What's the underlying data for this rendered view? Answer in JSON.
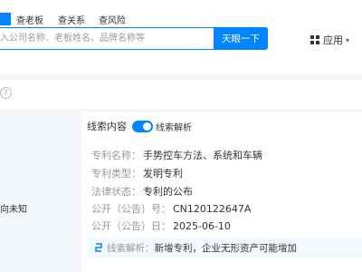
{
  "header": {
    "quick_tabs": [
      "查老板",
      "查关系",
      "查风险"
    ],
    "search": {
      "placeholder": "入公司名称、老板姓名、品牌名称等",
      "button_label": "天眼一下"
    },
    "apps_label": "应用"
  },
  "side": {
    "note": "向未知"
  },
  "clue": {
    "title": "线索内容",
    "toggle_label": "线索解析",
    "fields": [
      {
        "key": "专利名称：",
        "value": "手势控车方法、系统和车辆"
      },
      {
        "key": "专利类型：",
        "value": "发明专利"
      },
      {
        "key": "法律状态：",
        "value": "专利的公布"
      },
      {
        "key": "公开（公告）号：",
        "value": "CN120122647A"
      },
      {
        "key": "公开（公告）日：",
        "value": "2025-06-10"
      }
    ],
    "analysis_key": "线索解析：",
    "analysis_value": "新增专利，企业无形资产可能增加"
  },
  "colors": {
    "accent": "#0084ff",
    "label_gray": "#999999",
    "analysis_bg": "#f3f8ff"
  }
}
